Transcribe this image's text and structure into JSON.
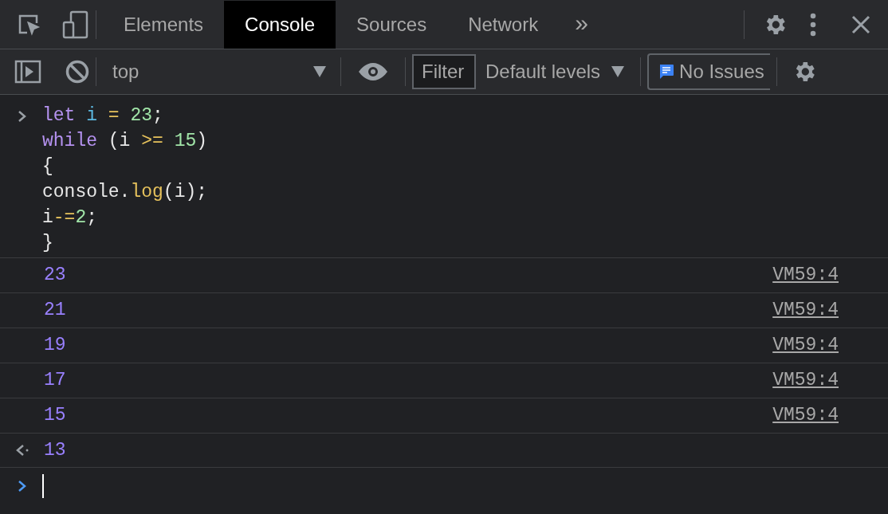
{
  "tabs": [
    {
      "label": "Elements",
      "selected": false
    },
    {
      "label": "Console",
      "selected": true
    },
    {
      "label": "Sources",
      "selected": false
    },
    {
      "label": "Network",
      "selected": false
    }
  ],
  "more_tabs": "»",
  "toolbar": {
    "context": "top",
    "filter": {
      "placeholder": "Filter"
    },
    "levels": "Default levels",
    "issues": "No Issues"
  },
  "input_code": [
    [
      {
        "kind": "keyword",
        "text": "let "
      },
      {
        "kind": "variable",
        "text": "i "
      },
      {
        "kind": "operator",
        "text": "= "
      },
      {
        "kind": "number",
        "text": "23"
      },
      {
        "kind": "plain",
        "text": ";"
      }
    ],
    [
      {
        "kind": "keyword",
        "text": "while"
      },
      {
        "kind": "plain",
        "text": " (i "
      },
      {
        "kind": "operator",
        "text": ">= "
      },
      {
        "kind": "number",
        "text": "15"
      },
      {
        "kind": "plain",
        "text": ")"
      }
    ],
    [
      {
        "kind": "plain",
        "text": "{"
      }
    ],
    [
      {
        "kind": "plain",
        "text": "console."
      },
      {
        "kind": "method",
        "text": "log"
      },
      {
        "kind": "plain",
        "text": "(i);"
      }
    ],
    [
      {
        "kind": "plain",
        "text": "i"
      },
      {
        "kind": "operator",
        "text": "-="
      },
      {
        "kind": "number",
        "text": "2"
      },
      {
        "kind": "plain",
        "text": ";"
      }
    ],
    [
      {
        "kind": "plain",
        "text": "}"
      }
    ]
  ],
  "log_rows": [
    {
      "value": "23",
      "source": "VM59:4"
    },
    {
      "value": "21",
      "source": "VM59:4"
    },
    {
      "value": "19",
      "source": "VM59:4"
    },
    {
      "value": "17",
      "source": "VM59:4"
    },
    {
      "value": "15",
      "source": "VM59:4"
    }
  ],
  "result": "13"
}
